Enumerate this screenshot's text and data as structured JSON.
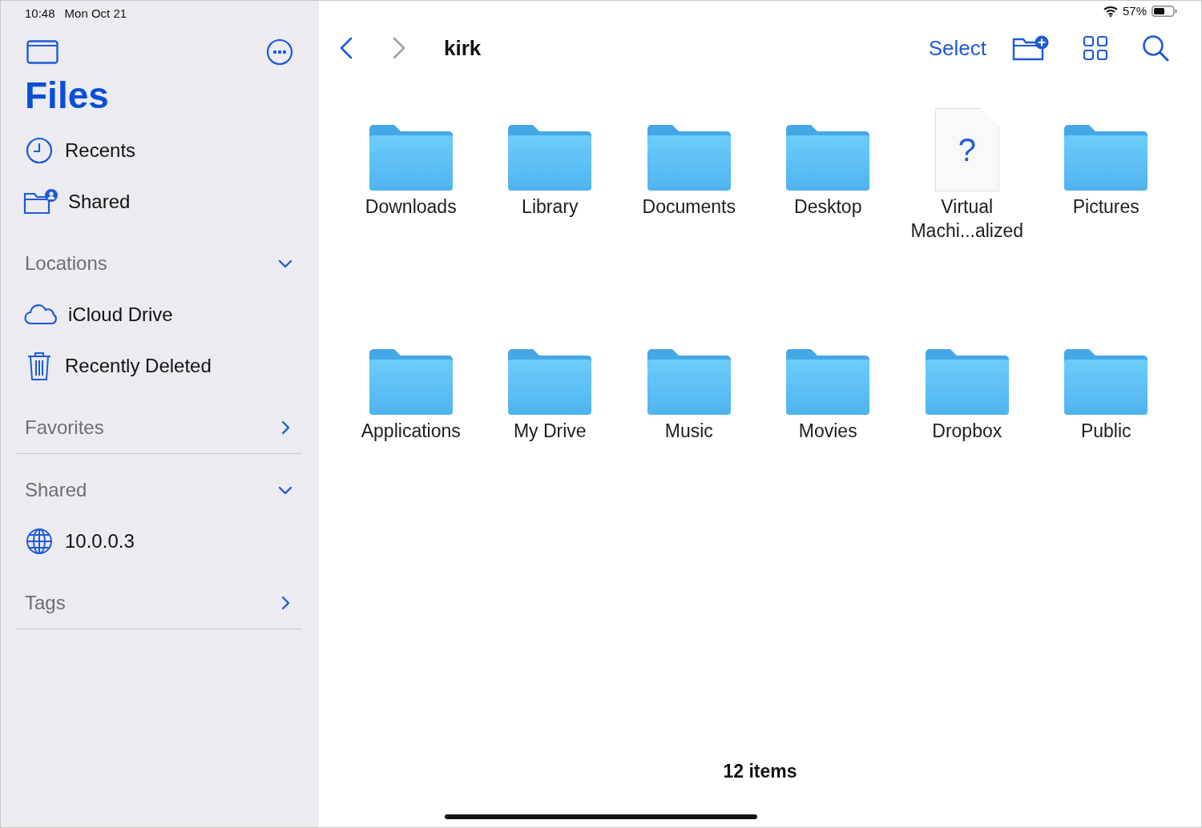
{
  "status_bar": {
    "time": "10:48",
    "date": "Mon Oct 21",
    "battery": "57%"
  },
  "sidebar": {
    "title": "Files",
    "top_items": [
      {
        "label": "Recents",
        "kind": "recents"
      },
      {
        "label": "Shared",
        "kind": "shared"
      }
    ],
    "groups": [
      {
        "sections": [
          {
            "title": "Locations",
            "expanded": true,
            "items": [
              {
                "label": "iCloud Drive",
                "kind": "cloud"
              },
              {
                "label": "Recently Deleted",
                "kind": "deleted"
              }
            ]
          },
          {
            "title": "Favorites",
            "expanded": false
          }
        ]
      },
      {
        "sections": [
          {
            "title": "Shared",
            "expanded": true,
            "items": [
              {
                "label": "10.0.0.3",
                "kind": "server"
              }
            ]
          },
          {
            "title": "Tags",
            "expanded": false
          }
        ]
      }
    ]
  },
  "toolbar": {
    "back": {
      "disabled": false
    },
    "forward": {
      "disabled": true
    },
    "title": "kirk",
    "select": "Select"
  },
  "files": [
    {
      "name": "Downloads",
      "kind": "folder"
    },
    {
      "name": "Library",
      "kind": "folder"
    },
    {
      "name": "Documents",
      "kind": "folder"
    },
    {
      "name": "Desktop",
      "kind": "folder"
    },
    {
      "name": "Virtual Machi...alized",
      "kind": "document",
      "glyph": "?"
    },
    {
      "name": "Pictures",
      "kind": "folder"
    },
    {
      "name": "Applications",
      "kind": "folder"
    },
    {
      "name": "My Drive",
      "kind": "folder"
    },
    {
      "name": "Music",
      "kind": "folder"
    },
    {
      "name": "Movies",
      "kind": "folder"
    },
    {
      "name": "Dropbox",
      "kind": "folder"
    },
    {
      "name": "Public",
      "kind": "folder"
    }
  ],
  "footer": "12 items"
}
